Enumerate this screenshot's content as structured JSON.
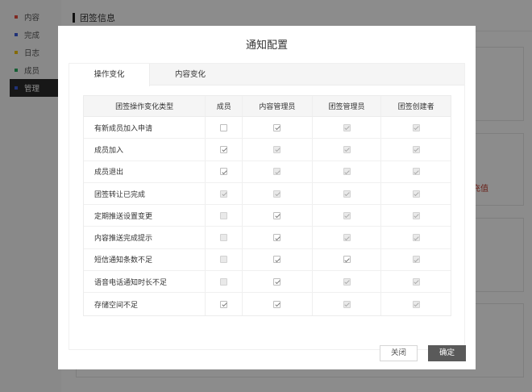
{
  "sidebar": {
    "items": [
      {
        "label": "内容",
        "color": "#e74c3c"
      },
      {
        "label": "完成",
        "color": "#3b5bdb"
      },
      {
        "label": "日志",
        "color": "#f1c40f"
      },
      {
        "label": "成员",
        "color": "#27ae60"
      },
      {
        "label": "管理",
        "color": "#3b5bdb"
      }
    ],
    "active_index": 4
  },
  "background": {
    "header_title": "团签信息",
    "red_text": "充值"
  },
  "modal": {
    "title": "通知配置",
    "tabs": [
      {
        "label": "操作变化",
        "active": true
      },
      {
        "label": "内容变化",
        "active": false
      }
    ],
    "columns": [
      "团签操作变化类型",
      "成员",
      "内容管理员",
      "团签管理员",
      "团签创建者"
    ],
    "rows": [
      {
        "type": "有新成员加入申请",
        "member": {
          "checked": false,
          "disabled": false
        },
        "content_admin": {
          "checked": true,
          "disabled": false
        },
        "team_admin": {
          "checked": true,
          "disabled": true
        },
        "creator": {
          "checked": true,
          "disabled": true
        }
      },
      {
        "type": "成员加入",
        "member": {
          "checked": true,
          "disabled": false
        },
        "content_admin": {
          "checked": true,
          "disabled": true
        },
        "team_admin": {
          "checked": true,
          "disabled": true
        },
        "creator": {
          "checked": true,
          "disabled": true
        }
      },
      {
        "type": "成员退出",
        "member": {
          "checked": true,
          "disabled": false
        },
        "content_admin": {
          "checked": true,
          "disabled": true
        },
        "team_admin": {
          "checked": true,
          "disabled": true
        },
        "creator": {
          "checked": true,
          "disabled": true
        }
      },
      {
        "type": "团签转让已完成",
        "member": {
          "checked": true,
          "disabled": true
        },
        "content_admin": {
          "checked": true,
          "disabled": true
        },
        "team_admin": {
          "checked": true,
          "disabled": true
        },
        "creator": {
          "checked": true,
          "disabled": true
        }
      },
      {
        "type": "定期推送设置变更",
        "member": {
          "checked": false,
          "disabled": true
        },
        "content_admin": {
          "checked": true,
          "disabled": false
        },
        "team_admin": {
          "checked": true,
          "disabled": true
        },
        "creator": {
          "checked": true,
          "disabled": true
        }
      },
      {
        "type": "内容推送完成提示",
        "member": {
          "checked": false,
          "disabled": true
        },
        "content_admin": {
          "checked": true,
          "disabled": false
        },
        "team_admin": {
          "checked": true,
          "disabled": true
        },
        "creator": {
          "checked": true,
          "disabled": true
        }
      },
      {
        "type": "短信通知条数不足",
        "member": {
          "checked": false,
          "disabled": true
        },
        "content_admin": {
          "checked": true,
          "disabled": false
        },
        "team_admin": {
          "checked": true,
          "disabled": false
        },
        "creator": {
          "checked": true,
          "disabled": true
        }
      },
      {
        "type": "语音电话通知时长不足",
        "member": {
          "checked": false,
          "disabled": true
        },
        "content_admin": {
          "checked": true,
          "disabled": false
        },
        "team_admin": {
          "checked": true,
          "disabled": true
        },
        "creator": {
          "checked": true,
          "disabled": true
        }
      },
      {
        "type": "存储空间不足",
        "member": {
          "checked": true,
          "disabled": false
        },
        "content_admin": {
          "checked": true,
          "disabled": false
        },
        "team_admin": {
          "checked": true,
          "disabled": true
        },
        "creator": {
          "checked": true,
          "disabled": true
        }
      }
    ],
    "buttons": {
      "close_label": "关闭",
      "ok_label": "确定"
    }
  }
}
